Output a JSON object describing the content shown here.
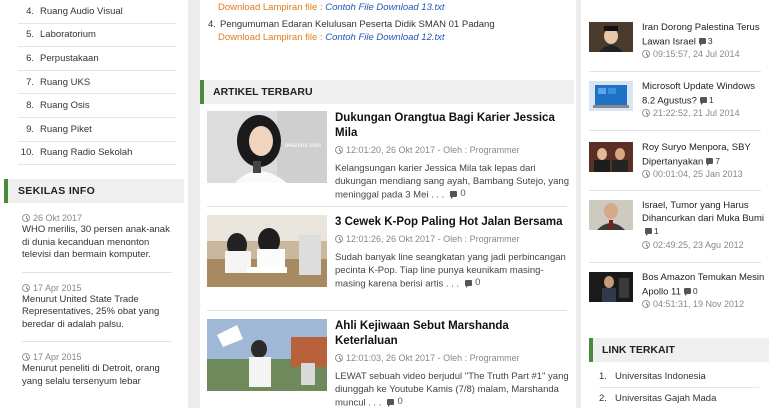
{
  "left": {
    "list": [
      {
        "n": "4.",
        "label": "Ruang Audio Visual"
      },
      {
        "n": "5.",
        "label": "Laboratorium"
      },
      {
        "n": "6.",
        "label": "Perpustakaan"
      },
      {
        "n": "7.",
        "label": "Ruang UKS"
      },
      {
        "n": "8.",
        "label": "Ruang Osis"
      },
      {
        "n": "9.",
        "label": "Ruang Piket"
      },
      {
        "n": "10.",
        "label": "Ruang Radio Sekolah"
      }
    ],
    "sekilas_title": "SEKILAS INFO",
    "sekilas": [
      {
        "date": "26 Okt 2017",
        "text": "WHO merilis, 30 persen anak-anak di dunia kecanduan menonton televisi dan bermain komputer."
      },
      {
        "date": "17 Apr 2015",
        "text": "Menurut United State Trade Representatives, 25% obat yang beredar di adalah palsu."
      },
      {
        "date": "17 Apr 2015",
        "text": "Menurut peneliti di Detroit, orang yang selalu tersenyum lebar"
      }
    ]
  },
  "mid": {
    "dl_prefix": "Download Lampiran file :",
    "dl1_file": "Contoh File Download 13.txt",
    "peng_n": "4.",
    "peng_text": "Pengumuman Edaran Kelulusan Peserta Didik SMAN 01 Padang",
    "dl2_file": "Contoh File Download 12.txt",
    "artikel_title": "ARTIKEL TERBARU",
    "articles": [
      {
        "title": "Dukungan Orangtua Bagi Karier Jessica Mila",
        "meta": "12:01:20, 26 Okt 2017 - Oleh : Programmer",
        "excerpt": "Kelangsungan karier Jessica Mila tak lepas dari dukungan mendiang sang ayah, Bambang Sutejo, yang meninggal pada 3 Mei . . .",
        "comments": "0"
      },
      {
        "title": "3 Cewek K-Pop Paling Hot Jalan Bersama",
        "meta": "12:01:26, 26 Okt 2017 - Oleh : Programmer",
        "excerpt": "Sudah banyak line seangkatan yang jadi perbincangan pecinta K-Pop. Tiap line punya keunikam masing-masing karena berisi artis . . .",
        "comments": "0"
      },
      {
        "title": "Ahli Kejiwaan Sebut Marshanda Keterlaluan",
        "meta": "12:01:03, 26 Okt 2017 - Oleh : Programmer",
        "excerpt": "LEWAT sebuah video berjudul \"The Truth Part #1\" yang diunggah ke Youtube Kamis (7/8) malam, Marshanda muncul . . .",
        "comments": "0"
      }
    ]
  },
  "right": {
    "popular": [
      {
        "title": "Iran Dorong Palestina Terus Lawan Israel",
        "count": "3",
        "date": "09:15:57, 24 Jul 2014"
      },
      {
        "title": "Microsoft Update Windows 8.2 Agustus?",
        "count": "1",
        "date": "21:22:52, 21 Jul 2014"
      },
      {
        "title": "Roy Suryo Menpora, SBY Dipertanyakan",
        "count": "7",
        "date": "00:01:04, 25 Jan 2013"
      },
      {
        "title": "Israel, Tumor yang Harus Dihancurkan dari Muka Bumi",
        "count": "1",
        "date": "02:49:25, 23 Agu 2012"
      },
      {
        "title": "Bos Amazon Temukan Mesin Apollo 11",
        "count": "0",
        "date": "04:51:31, 19 Nov 2012"
      }
    ],
    "link_title": "LINK TERKAIT",
    "links": [
      {
        "n": "1.",
        "label": "Universitas Indonesia"
      },
      {
        "n": "2.",
        "label": "Universitas Gajah Mada"
      }
    ]
  }
}
